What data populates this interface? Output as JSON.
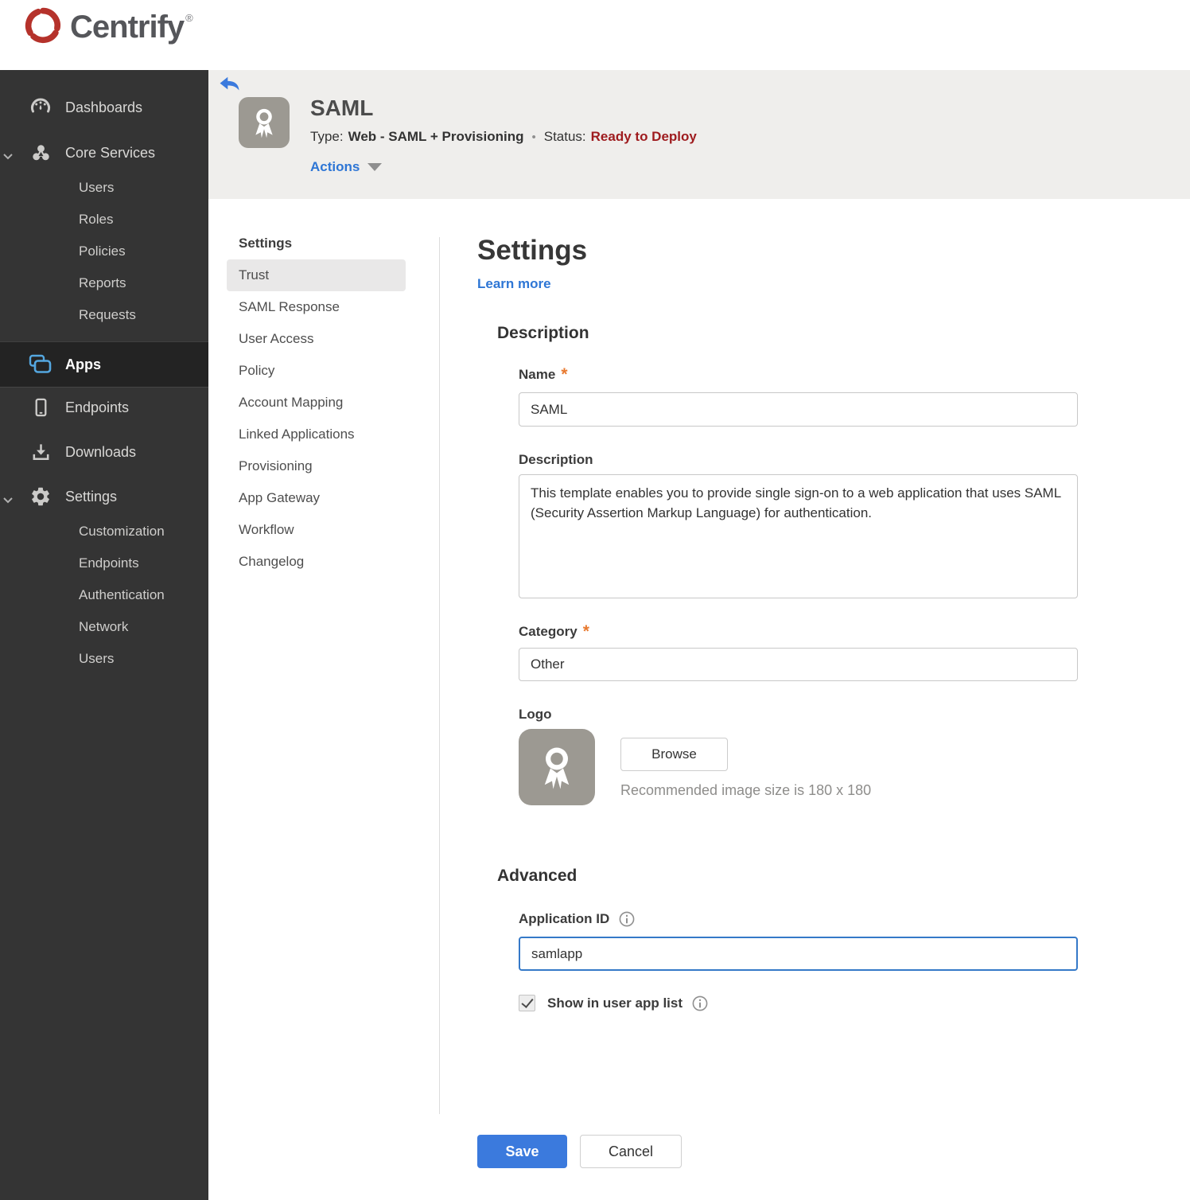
{
  "brand": {
    "name": "Centrify",
    "trademark": "®"
  },
  "sidebar": {
    "items": [
      {
        "label": "Dashboards"
      },
      {
        "label": "Core Services",
        "children": [
          "Users",
          "Roles",
          "Policies",
          "Reports",
          "Requests"
        ]
      },
      {
        "label": "Apps",
        "active": true
      },
      {
        "label": "Endpoints"
      },
      {
        "label": "Downloads"
      },
      {
        "label": "Settings",
        "children": [
          "Customization",
          "Endpoints",
          "Authentication",
          "Network",
          "Users"
        ]
      }
    ]
  },
  "header": {
    "app_name": "SAML",
    "type_label": "Type:",
    "type_value": "Web - SAML + Provisioning",
    "separator": "•",
    "status_label": "Status:",
    "status_value": "Ready to Deploy",
    "actions_label": "Actions"
  },
  "subnav": {
    "title": "Settings",
    "selected": "Trust",
    "items": [
      "Trust",
      "SAML Response",
      "User Access",
      "Policy",
      "Account Mapping",
      "Linked Applications",
      "Provisioning",
      "App Gateway",
      "Workflow",
      "Changelog"
    ]
  },
  "main": {
    "title": "Settings",
    "learn_more_label": "Learn more",
    "required_marker": "*",
    "description": {
      "heading": "Description",
      "name_label": "Name",
      "name_value": "SAML",
      "description_label": "Description",
      "description_value": "This template enables you to provide single sign-on to a web application that uses SAML (Security Assertion Markup Language) for authentication.",
      "category_label": "Category",
      "category_value": "Other",
      "logo_label": "Logo",
      "browse_label": "Browse",
      "logo_hint": "Recommended image size is 180 x 180"
    },
    "advanced": {
      "heading": "Advanced",
      "application_id_label": "Application ID",
      "application_id_value": "samlapp",
      "show_in_user_app_list_label": "Show in user app list",
      "show_in_user_app_list_checked": true
    },
    "buttons": {
      "save_label": "Save",
      "cancel_label": "Cancel"
    }
  },
  "colors": {
    "brand_red": "#b5322b",
    "accent_blue": "#2e76d5",
    "save_blue": "#3b7add",
    "status_red": "#9e1b1e",
    "required_orange": "#e87a30",
    "sidebar_bg": "#343434",
    "header_bg": "#efeeec",
    "apps_icon_blue": "#54a7e0"
  }
}
